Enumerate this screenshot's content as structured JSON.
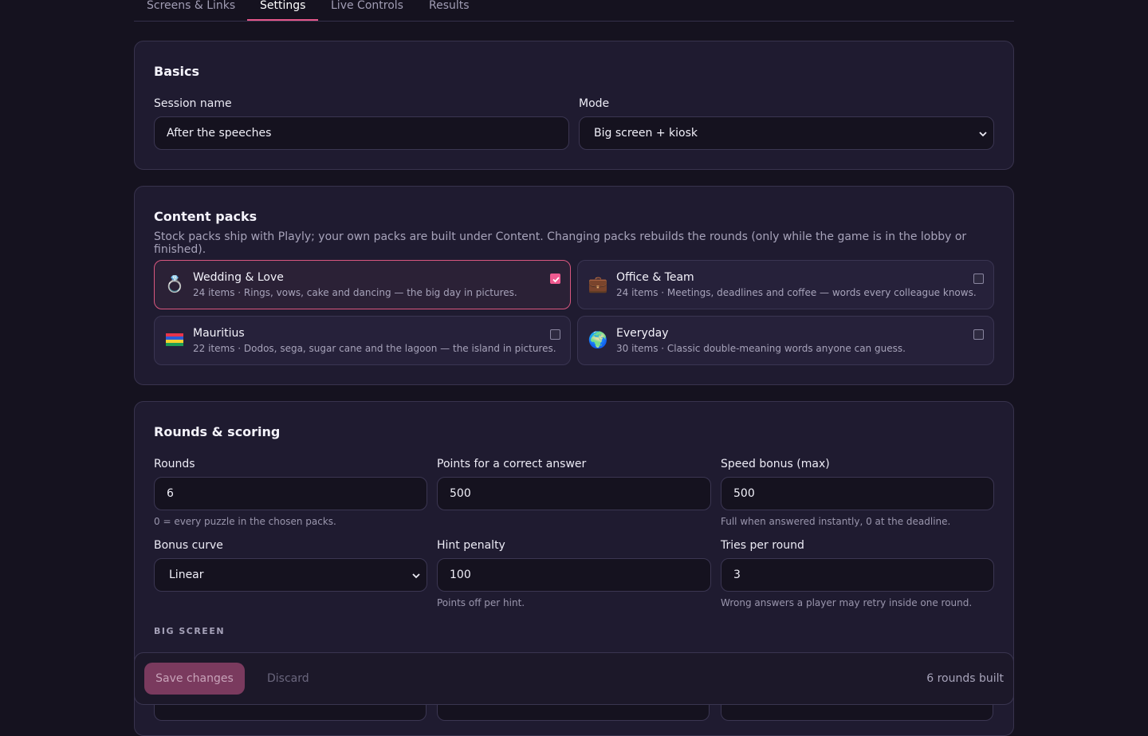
{
  "tabs": [
    {
      "label": "Screens & Links"
    },
    {
      "label": "Settings"
    },
    {
      "label": "Live Controls"
    },
    {
      "label": "Results"
    }
  ],
  "basics": {
    "title": "Basics",
    "session_name_label": "Session name",
    "session_name_value": "After the speeches",
    "mode_label": "Mode",
    "mode_value": "Big screen + kiosk"
  },
  "packs": {
    "title": "Content packs",
    "description": "Stock packs ship with Playly; your own packs are built under Content. Changing packs rebuilds the rounds (only while the game is in the lobby or finished).",
    "items": [
      {
        "name": "Wedding & Love",
        "desc": "24 items · Rings, vows, cake and dancing — the big day in pictures.",
        "icon": "ring-icon",
        "glyph": "💍",
        "checked": true
      },
      {
        "name": "Office & Team",
        "desc": "24 items · Meetings, deadlines and coffee — words every colleague knows.",
        "icon": "briefcase-icon",
        "glyph": "💼",
        "checked": false
      },
      {
        "name": "Mauritius",
        "desc": "22 items · Dodos, sega, sugar cane and the lagoon — the island in pictures.",
        "icon": "mauritius-flag-icon",
        "glyph": "",
        "checked": false
      },
      {
        "name": "Everyday",
        "desc": "30 items · Classic double-meaning words anyone can guess.",
        "icon": "globe-icon",
        "glyph": "🌍",
        "checked": false
      }
    ]
  },
  "rounds": {
    "title": "Rounds & scoring",
    "rounds_label": "Rounds",
    "rounds_value": "6",
    "rounds_help": "0 = every puzzle in the chosen packs.",
    "points_label": "Points for a correct answer",
    "points_value": "500",
    "speed_label": "Speed bonus (max)",
    "speed_value": "500",
    "speed_help": "Full when answered instantly, 0 at the deadline.",
    "curve_label": "Bonus curve",
    "curve_value": "Linear",
    "hint_label": "Hint penalty",
    "hint_value": "100",
    "hint_help": "Points off per hint.",
    "tries_label": "Tries per round",
    "tries_value": "3",
    "tries_help": "Wrong answers a player may retry inside one round.",
    "big_screen_caption": "BIG SCREEN"
  },
  "savebar": {
    "save_label": "Save changes",
    "discard_label": "Discard",
    "status": "6 rounds built"
  },
  "colors": {
    "accent": "#ef5a90",
    "background": "#15121f",
    "card": "#1f1b30"
  }
}
